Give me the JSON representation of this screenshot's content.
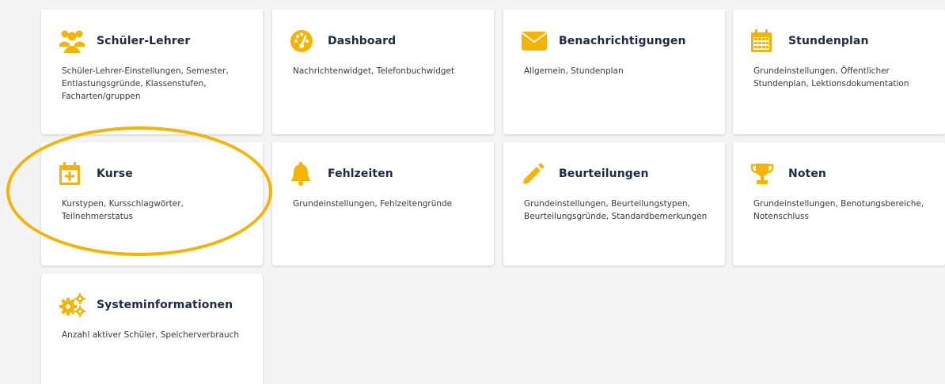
{
  "accent_color": "#f4b400",
  "cards": [
    {
      "key": "schueler-lehrer",
      "icon": "users-icon",
      "title": "Schüler-Lehrer",
      "description": "Schüler-Lehrer-Einstellungen, Semester, Entlastungsgründe, Klassenstufen, Facharten/gruppen"
    },
    {
      "key": "dashboard",
      "icon": "gauge-icon",
      "title": "Dashboard",
      "description": "Nachrichtenwidget, Telefonbuchwidget"
    },
    {
      "key": "benachrichtigungen",
      "icon": "envelope-icon",
      "title": "Benachrichtigungen",
      "description": "Allgemein, Stundenplan"
    },
    {
      "key": "stundenplan",
      "icon": "calendar-grid-icon",
      "title": "Stundenplan",
      "description": "Grundeinstellungen, Öffentlicher Stundenplan, Lektionsdokumentation"
    },
    {
      "key": "kurse",
      "icon": "calendar-plus-icon",
      "title": "Kurse",
      "description": "Kurstypen, Kursschlagwörter, Teilnehmerstatus"
    },
    {
      "key": "fehlzeiten",
      "icon": "bell-icon",
      "title": "Fehlzeiten",
      "description": "Grundeinstellungen, Fehlzeitengründe"
    },
    {
      "key": "beurteilungen",
      "icon": "pencil-icon",
      "title": "Beurteilungen",
      "description": "Grundeinstellungen, Beurteilungstypen, Beurteilungsgründe, Standardbemerkungen"
    },
    {
      "key": "noten",
      "icon": "trophy-icon",
      "title": "Noten",
      "description": "Grundeinstellungen, Benotungsbereiche, Notenschluss"
    },
    {
      "key": "systeminformationen",
      "icon": "gears-icon",
      "title": "Systeminformationen",
      "description": "Anzahl aktiver Schüler, Speicherverbrauch"
    }
  ]
}
